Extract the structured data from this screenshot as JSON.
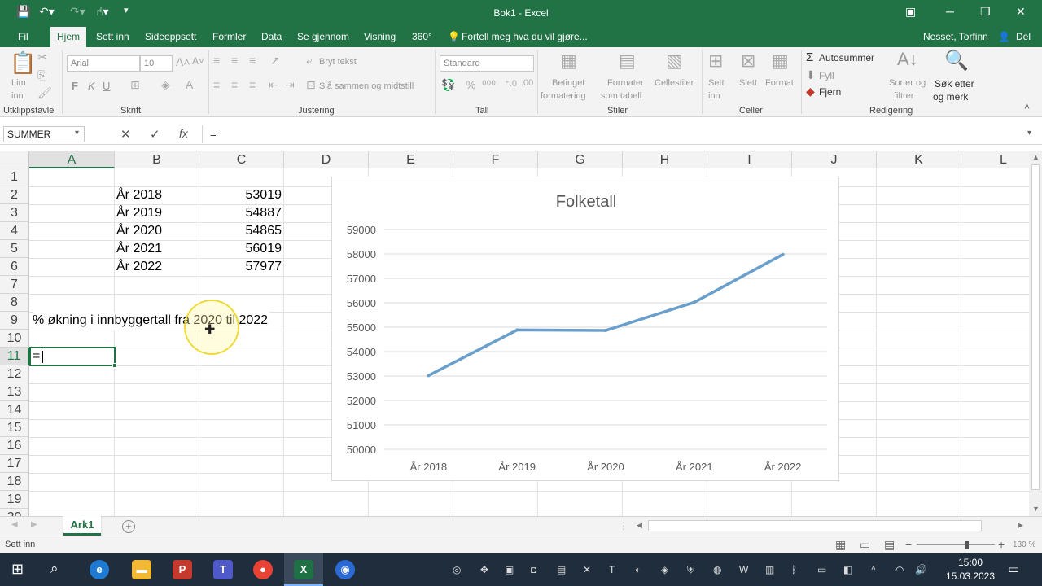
{
  "titlebar": {
    "title": "Bok1 - Excel"
  },
  "menu": {
    "tabs": [
      "Fil",
      "Hjem",
      "Sett inn",
      "Sideoppsett",
      "Formler",
      "Data",
      "Se gjennom",
      "Visning",
      "360°"
    ],
    "tell_me": "Fortell meg hva du vil gjøre...",
    "user": "Nesset, Torfinn",
    "share": "Del"
  },
  "ribbon": {
    "paste_1": "Lim",
    "paste_2": "inn",
    "font_name": "Arial",
    "font_size": "10",
    "bold": "F",
    "italic": "K",
    "underline": "U",
    "wrap_text": "Bryt tekst",
    "merge_center": "Slå sammen og midtstill",
    "number_format": "Standard",
    "cond_fmt_1": "Betinget",
    "cond_fmt_2": "formatering",
    "fmt_table_1": "Formater",
    "fmt_table_2": "som tabell",
    "cell_styles": "Cellestiler",
    "insert": "Sett",
    "insert_2": "inn",
    "delete": "Slett",
    "format": "Format",
    "autosum": "Autosummer",
    "fill": "Fyll",
    "clear": "Fjern",
    "sort_1": "Sorter og",
    "sort_2": "filtrer",
    "find_1": "Søk etter",
    "find_2": "og merk",
    "groups": [
      "Utklippstavle",
      "Skrift",
      "Justering",
      "Tall",
      "Stiler",
      "Celler",
      "Redigering"
    ]
  },
  "formula_bar": {
    "name_box": "SUMMER",
    "fx": "fx",
    "formula": "="
  },
  "grid": {
    "columns": [
      "A",
      "B",
      "C",
      "D",
      "E",
      "F",
      "G",
      "H",
      "I",
      "J",
      "K",
      "L"
    ],
    "rows": [
      "1",
      "2",
      "3",
      "4",
      "5",
      "6",
      "7",
      "8",
      "9",
      "10",
      "11",
      "12",
      "13",
      "14",
      "15",
      "16",
      "17",
      "18",
      "19",
      "20"
    ],
    "years": [
      "År 2018",
      "År 2019",
      "År 2020",
      "År 2021",
      "År 2022"
    ],
    "values": [
      "53019",
      "54887",
      "54865",
      "56019",
      "57977"
    ],
    "label_row9": "% økning i innbyggertall fra 2020 til 2022",
    "active_cell_text": "="
  },
  "chart_data": {
    "type": "line",
    "title": "Folketall",
    "categories": [
      "År 2018",
      "År 2019",
      "År 2020",
      "År 2021",
      "År 2022"
    ],
    "series": [
      {
        "values": [
          53019,
          54887,
          54865,
          56019,
          57977
        ]
      }
    ],
    "yticks": [
      "50000",
      "51000",
      "52000",
      "53000",
      "54000",
      "55000",
      "56000",
      "57000",
      "58000",
      "59000"
    ],
    "ylim": [
      50000,
      59000
    ],
    "grid": true,
    "line_color": "#6a9fcb"
  },
  "sheets": {
    "tabs": [
      "Ark1"
    ],
    "add": "+"
  },
  "status": {
    "mode": "Sett inn",
    "zoom": "130 %"
  },
  "taskbar": {
    "time": "15:00",
    "date": "15.03.2023"
  }
}
